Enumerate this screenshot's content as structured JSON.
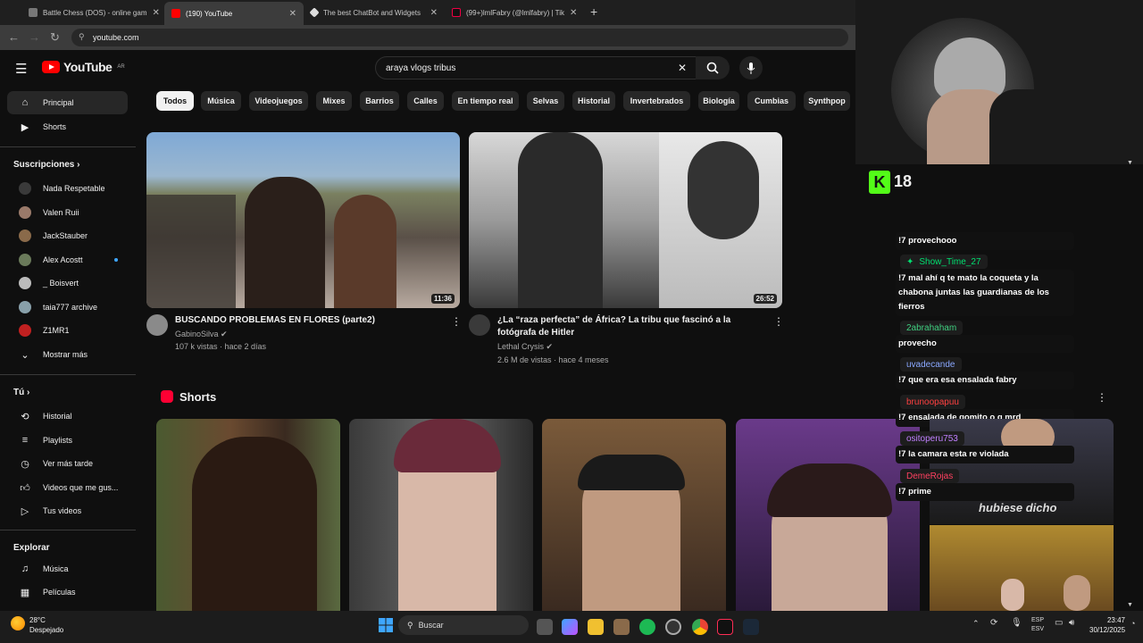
{
  "browser": {
    "tabs": [
      {
        "label": "Battle Chess (DOS) - online gam"
      },
      {
        "label": "(190) YouTube"
      },
      {
        "label": "The best ChatBot and Widgets"
      },
      {
        "label": "(99+)lmlFabry (@lmlfabry) | Tik"
      }
    ],
    "url": "youtube.com"
  },
  "yt": {
    "logo": "YouTube",
    "region": "AR",
    "search_value": "araya vlogs tribus"
  },
  "sidebar": {
    "main": [
      {
        "label": "Principal",
        "icon": "home-icon"
      },
      {
        "label": "Shorts",
        "icon": "shorts-icon"
      }
    ],
    "subs_title": "Suscripciones",
    "subs": [
      {
        "label": "Nada Respetable",
        "color": "#3a3a3a"
      },
      {
        "label": "Valen Ruii",
        "color": "#9a7a6a"
      },
      {
        "label": "JackStauber",
        "color": "#8a6a4a"
      },
      {
        "label": "Alex Acostt",
        "color": "#6a7a5a"
      },
      {
        "label": "_ Boisvert",
        "color": "#bbbbbb"
      },
      {
        "label": "taia777 archive",
        "color": "#88a0aa"
      },
      {
        "label": "Z1MR1",
        "color": "#c02020"
      }
    ],
    "more": "Mostrar más",
    "you_title": "Tú",
    "you": [
      {
        "label": "Historial",
        "icon": "history-icon"
      },
      {
        "label": "Playlists",
        "icon": "playlist-icon"
      },
      {
        "label": "Ver más tarde",
        "icon": "clock-icon"
      },
      {
        "label": "Videos que me gus...",
        "icon": "thumb-up-icon"
      },
      {
        "label": "Tus videos",
        "icon": "video-icon"
      }
    ],
    "explore_title": "Explorar",
    "explore": [
      {
        "label": "Música",
        "icon": "music-icon"
      },
      {
        "label": "Películas",
        "icon": "film-icon"
      }
    ]
  },
  "chips": [
    "Todos",
    "Música",
    "Videojuegos",
    "Mixes",
    "Barrios",
    "Calles",
    "En tiempo real",
    "Selvas",
    "Historial",
    "Invertebrados",
    "Biología",
    "Cumbias",
    "Synthpop"
  ],
  "videos": [
    {
      "title": "BUSCANDO PROBLEMAS EN FLORES (parte2)",
      "channel": "GabinoSilva",
      "meta": "107 k vistas · hace 2 días",
      "duration": "11:36"
    },
    {
      "title1": "¿La “raza perfecta” de África? La tribu que fascinó a la",
      "title2": "fotógrafa de Hitler",
      "channel": "Lethal Crysis",
      "meta": "2.6 M de vistas · hace 4 meses",
      "duration": "26:52"
    }
  ],
  "shorts_title": "Shorts",
  "overlay": {
    "kick_count": "18",
    "overlay_text": "hubiese dicho"
  },
  "chat": [
    {
      "name": null,
      "msg": "!7 provechooo"
    },
    {
      "name": "Show_Time_27",
      "color": "#00e070",
      "msg1": "!7 mal ahí q te mato la coqueta y la",
      "msg2": "chabona juntas las guardianas de los",
      "msg3": "fierros"
    },
    {
      "name": "2abrahaham",
      "color": "#40d080",
      "msg": "provecho"
    },
    {
      "name": "uvadecande",
      "color": "#8aa8ff",
      "msg": "!7 que era esa ensalada fabry"
    },
    {
      "name": "brunoopapuu",
      "color": "#ff4040",
      "msg": "!7 ensalada de gomito o q mrd"
    },
    {
      "name": "ositoperu753",
      "color": "#c080ff",
      "msg": "!7 la camara esta re violada"
    },
    {
      "name": "DemeRojas",
      "color": "#ff4060",
      "msg": "!7 prime"
    }
  ],
  "taskbar": {
    "temp": "28°C",
    "weather": "Despejado",
    "search": "Buscar",
    "lang1": "ESP",
    "lang2": "ESV",
    "time": "23:47",
    "date": "30/12/2025"
  }
}
